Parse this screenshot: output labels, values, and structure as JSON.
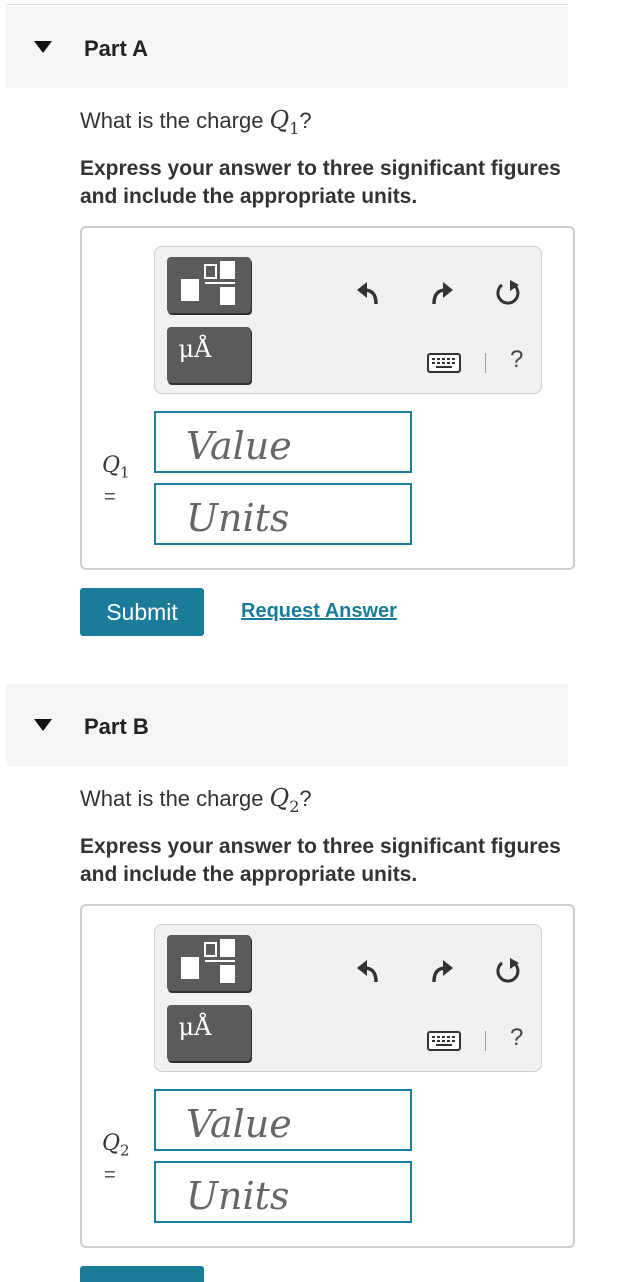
{
  "colors": {
    "accent": "#1a7c99",
    "toolbar_button": "#5b5b5b",
    "header_bg": "#f6f6f6"
  },
  "parts": [
    {
      "title": "Part A",
      "question_prefix": "What is the charge ",
      "var_letter": "Q",
      "var_sub": "1",
      "question_suffix": "?",
      "instruction": "Express your answer to three significant figures and include the appropriate units.",
      "eq": "=",
      "value_placeholder": "Value",
      "units_placeholder": "Units",
      "units_template_label": "μÅ",
      "help": "?",
      "submit_label": "Submit",
      "request_label": "Request Answer"
    },
    {
      "title": "Part B",
      "question_prefix": "What is the charge ",
      "var_letter": "Q",
      "var_sub": "2",
      "question_suffix": "?",
      "instruction": "Express your answer to three significant figures and include the appropriate units.",
      "eq": "=",
      "value_placeholder": "Value",
      "units_placeholder": "Units",
      "units_template_label": "μÅ",
      "help": "?"
    }
  ],
  "icons": {
    "template": "fraction-template-icon",
    "undo": "undo-icon",
    "redo": "redo-icon",
    "reset": "reset-icon",
    "keyboard": "keyboard-icon"
  }
}
